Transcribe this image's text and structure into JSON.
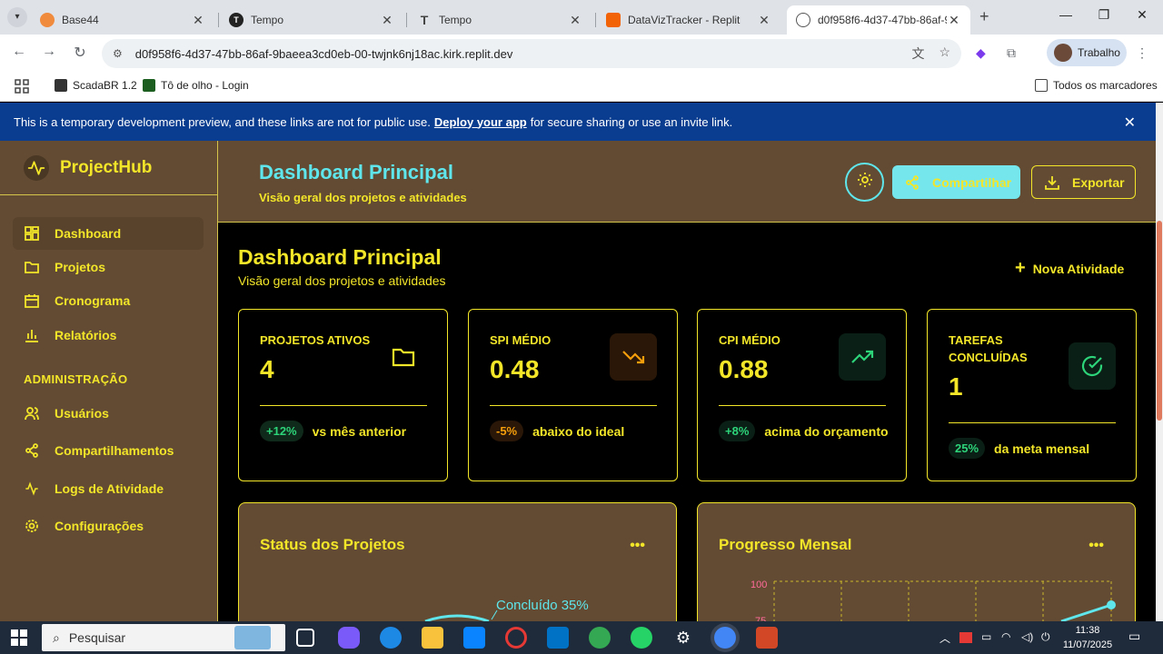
{
  "browser": {
    "tabs": [
      {
        "title": "Base44",
        "active": false
      },
      {
        "title": "Tempo",
        "active": false
      },
      {
        "title": "Tempo",
        "active": false
      },
      {
        "title": "DataVizTracker - Replit",
        "active": false
      },
      {
        "title": "d0f958f6-4d37-47bb-86af-9",
        "active": true
      }
    ],
    "url": "d0f958f6-4d37-47bb-86af-9baeea3cd0eb-00-twjnk6nj18ac.kirk.replit.dev",
    "profile_name": "Trabalho",
    "bookmarks": [
      "ScadaBR 1.2",
      "Tô de olho - Login"
    ],
    "all_bookmarks": "Todos os marcadores"
  },
  "banner": {
    "text_before": "This is a temporary development preview, and these links are not for public use.",
    "link": "Deploy your app",
    "text_after": "for secure sharing or use an invite link."
  },
  "app": {
    "brand": "ProjectHub",
    "nav": [
      {
        "label": "Dashboard",
        "icon": "dashboard-icon",
        "active": true
      },
      {
        "label": "Projetos",
        "icon": "folder-icon"
      },
      {
        "label": "Cronograma",
        "icon": "calendar-icon"
      },
      {
        "label": "Relatórios",
        "icon": "bar-chart-icon"
      }
    ],
    "admin_section": "ADMINISTRAÇÃO",
    "admin_nav": [
      {
        "label": "Usuários",
        "icon": "users-icon"
      },
      {
        "label": "Compartilhamentos",
        "icon": "share-icon"
      },
      {
        "label": "Logs de Atividade",
        "icon": "activity-icon"
      },
      {
        "label": "Configurações",
        "icon": "gear-icon"
      }
    ],
    "header": {
      "title": "Dashboard Principal",
      "subtitle": "Visão geral dos projetos e atividades",
      "share_label": "Compartilhar",
      "export_label": "Exportar"
    },
    "content": {
      "title": "Dashboard Principal",
      "subtitle": "Visão geral dos projetos e atividades",
      "new_activity": "Nova Atividade"
    },
    "cards": [
      {
        "label": "PROJETOS ATIVOS",
        "value": "4",
        "badge": "+12%",
        "note": "vs mês anterior",
        "icon": "folder-icon"
      },
      {
        "label": "SPI MÉDIO",
        "value": "0.48",
        "badge": "-5%",
        "note": "abaixo do ideal",
        "icon": "trending-down-icon"
      },
      {
        "label": "CPI MÉDIO",
        "value": "0.88",
        "badge": "+8%",
        "note": "acima do orçamento",
        "icon": "trending-up-icon"
      },
      {
        "label_line1": "TAREFAS",
        "label_line2": "CONCLUÍDAS",
        "value": "1",
        "badge": "25%",
        "note": "da meta mensal",
        "icon": "check-circle-icon"
      }
    ],
    "panels": [
      {
        "title": "Status dos Projetos",
        "menu": "•••",
        "slice_label": "Concluído 35%"
      },
      {
        "title": "Progresso Mensal",
        "menu": "•••",
        "y_tick_top": "100",
        "y_tick_next": "75"
      }
    ],
    "colors": {
      "accent": "#f3e629",
      "cyan": "#5ee6ec",
      "panel_bg": "#634b33",
      "green": "#2dd47a",
      "orange": "#f59e0b"
    }
  },
  "taskbar": {
    "search_placeholder": "Pesquisar",
    "time": "11:38",
    "date": "11/07/2025"
  }
}
